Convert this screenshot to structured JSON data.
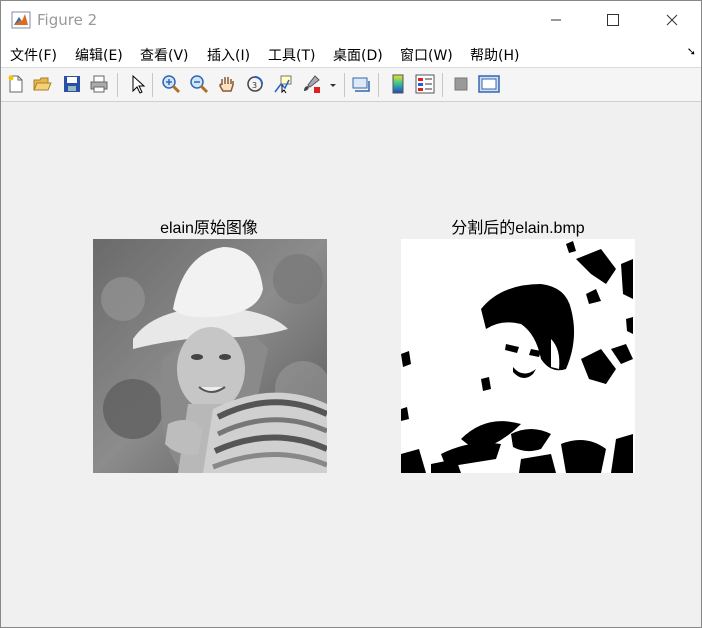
{
  "window": {
    "title": "Figure 2"
  },
  "menu": [
    "文件(F)",
    "编辑(E)",
    "查看(V)",
    "插入(I)",
    "工具(T)",
    "桌面(D)",
    "窗口(W)",
    "帮助(H)"
  ],
  "toolbar_icons": [
    "new-figure-icon",
    "open-file-icon",
    "save-icon",
    "print-icon",
    "pointer-icon",
    "zoom-in-icon",
    "zoom-out-icon",
    "pan-hand-icon",
    "rotate-3d-icon",
    "data-cursor-icon",
    "brush-icon",
    "brush-dropdown-icon",
    "link-plot-icon",
    "colorbar-icon",
    "legend-icon",
    "hide-plot-tools-icon",
    "show-plot-tools-icon"
  ],
  "axes": [
    {
      "title": "elain原始图像",
      "image": "grayscale photo of a smiling woman wearing a white sun hat and a striped scarf"
    },
    {
      "title": "分割后的elain.bmp",
      "image": "binary black-and-white segmentation of the same photo"
    }
  ]
}
